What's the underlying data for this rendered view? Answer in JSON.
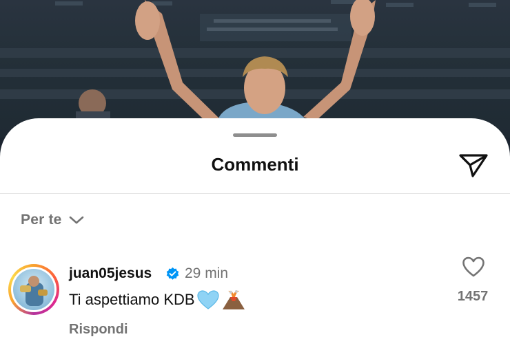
{
  "sheet": {
    "title": "Commenti",
    "send_icon": "paper-plane-icon",
    "sort": {
      "label": "Per te",
      "icon": "chevron-down-icon"
    }
  },
  "comment": {
    "username": "juan05jesus",
    "verified": true,
    "time": "29 min",
    "text": "Ti aspettiamo KDB",
    "emojis": [
      "light-blue-heart",
      "volcano"
    ],
    "reply_label": "Rispondi",
    "like_count": "1457",
    "like_icon": "heart-outline-icon"
  },
  "colors": {
    "text_primary": "#111111",
    "text_secondary": "#737373",
    "verified_blue": "#0095f6",
    "sheet_bg": "#ffffff"
  }
}
